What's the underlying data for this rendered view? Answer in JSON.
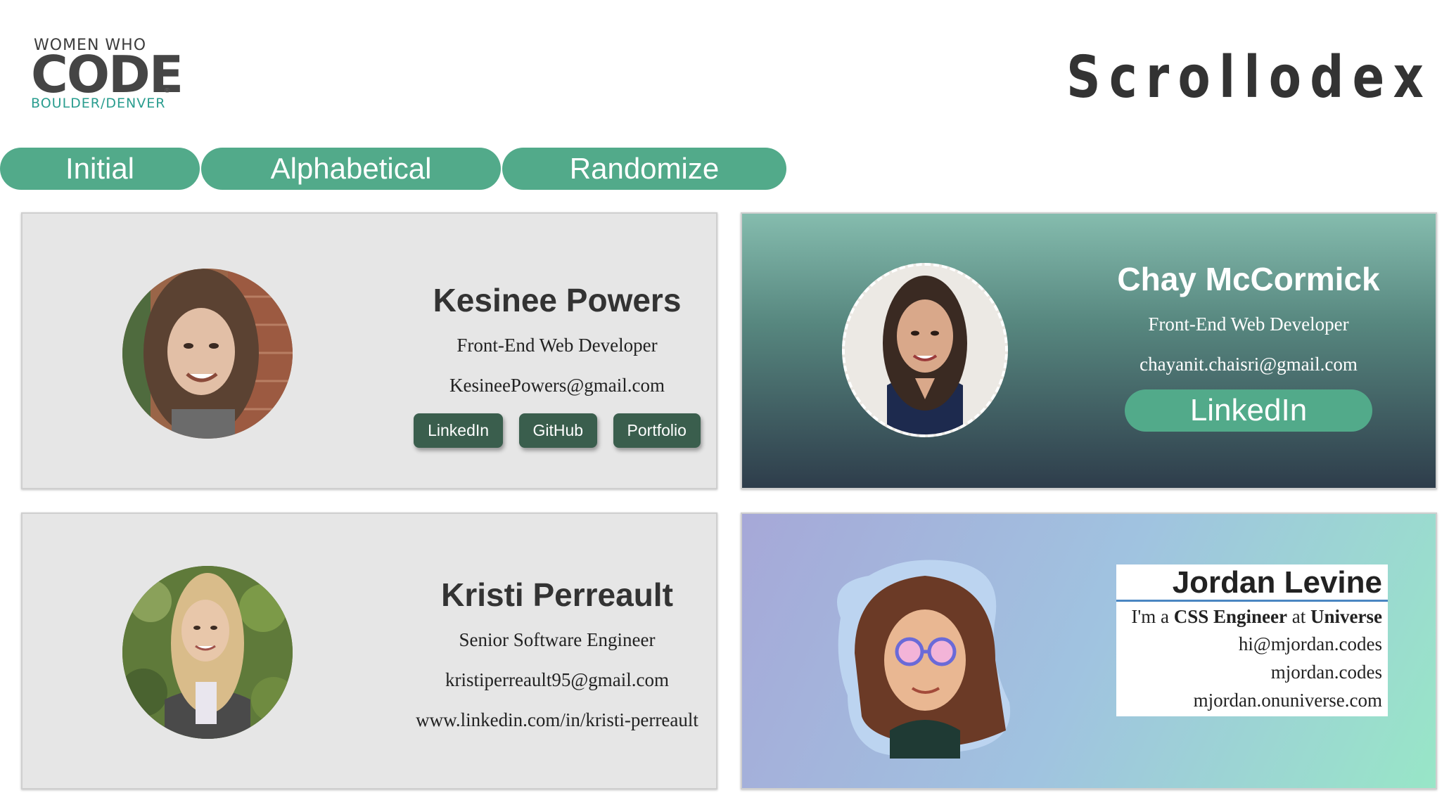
{
  "logo": {
    "line1": "WOMEN WHO",
    "line2": "CODE",
    "reg": "®",
    "line3": "BOULDER/DENVER"
  },
  "app_title": "Scrollodex",
  "sort_buttons": {
    "initial": "Initial",
    "alphabetical": "Alphabetical",
    "randomize": "Randomize"
  },
  "cards": [
    {
      "name": "Kesinee Powers",
      "role": "Front-End Web Developer",
      "email": "KesineePowers@gmail.com",
      "buttons": [
        "LinkedIn",
        "GitHub",
        "Portfolio"
      ]
    },
    {
      "name": "Chay McCormick",
      "role": "Front-End Web Developer",
      "email": "chayanit.chaisri@gmail.com",
      "button": "LinkedIn"
    },
    {
      "name": "Kristi Perreault",
      "role": "Senior Software Engineer",
      "email": "kristiperreault95@gmail.com",
      "link": "www.linkedin.com/in/kristi-perreault"
    },
    {
      "name": "Jordan Levine",
      "tag_pre": "I'm a ",
      "tag_role": "CSS Engineer",
      "tag_mid": " at ",
      "tag_company": "Universe",
      "email": "hi@mjordan.codes",
      "site": "mjordan.codes",
      "site2": "mjordan.onuniverse.com"
    }
  ],
  "colors": {
    "accent": "#52aa8a",
    "button_dark": "#3a5e4d",
    "logo_teal": "#2a9d8f"
  }
}
